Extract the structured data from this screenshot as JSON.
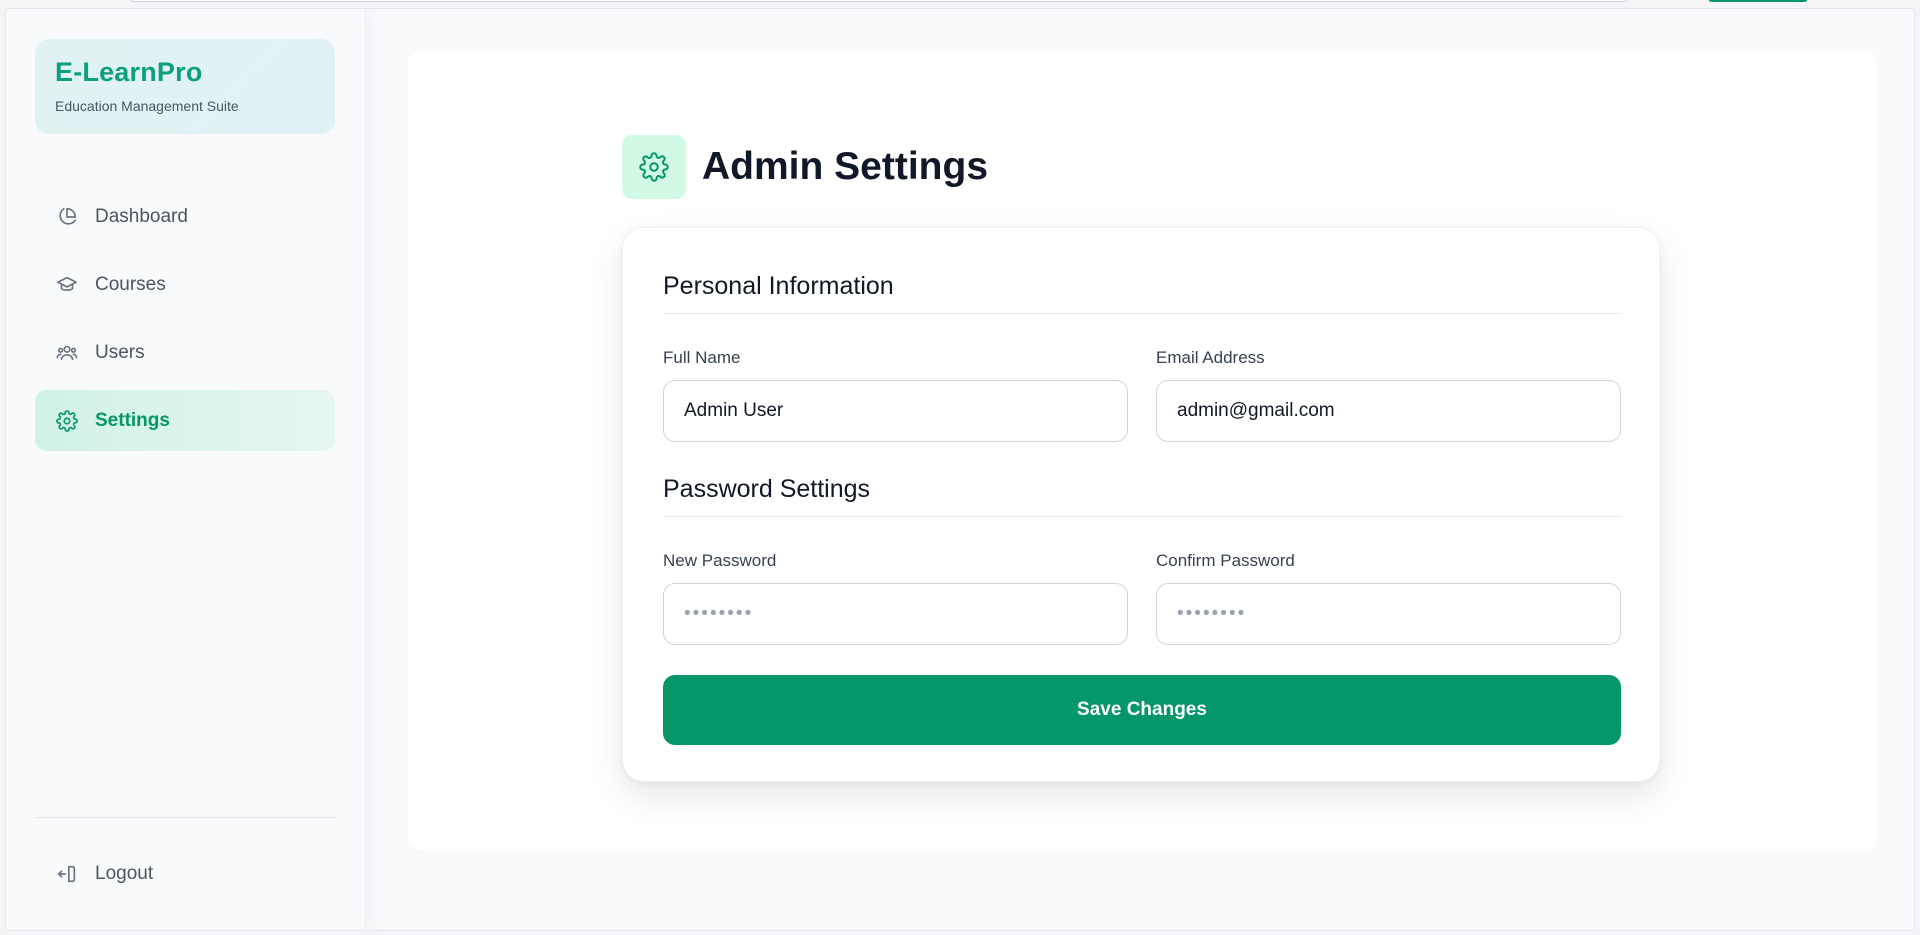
{
  "brand": {
    "title": "E-LearnPro",
    "subtitle": "Education Management Suite"
  },
  "sidebar": {
    "items": [
      {
        "label": "Dashboard",
        "icon": "pie-chart-icon"
      },
      {
        "label": "Courses",
        "icon": "graduation-cap-icon"
      },
      {
        "label": "Users",
        "icon": "users-icon"
      },
      {
        "label": "Settings",
        "icon": "gear-icon",
        "active": true
      }
    ],
    "logout_label": "Logout",
    "logout_icon": "logout-icon"
  },
  "page": {
    "title": "Admin Settings",
    "title_icon": "gear-icon"
  },
  "form": {
    "personal_title": "Personal Information",
    "full_name_label": "Full Name",
    "full_name_value": "Admin User",
    "email_label": "Email Address",
    "email_value": "admin@gmail.com",
    "password_title": "Password Settings",
    "new_password_label": "New Password",
    "new_password_placeholder": "••••••••",
    "confirm_password_label": "Confirm Password",
    "confirm_password_placeholder": "••••••••",
    "save_label": "Save Changes"
  },
  "colors": {
    "accent": "#059669",
    "brand_text": "#0d9f7e",
    "icon_bg": "#d1fae5",
    "active_nav_bg": "#d1f2e6"
  }
}
